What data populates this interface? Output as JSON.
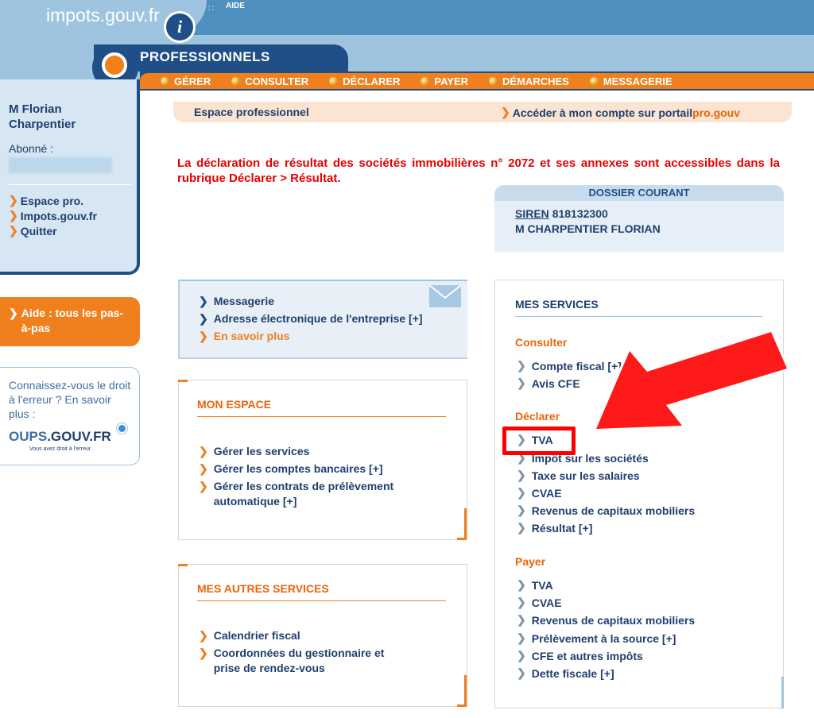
{
  "header": {
    "brand": "impots.gouv.fr",
    "info_glyph": "i",
    "aide_label": "AIDE",
    "section_title": "PROFESSIONNELS"
  },
  "nav": {
    "items": [
      {
        "label": "GÉRER"
      },
      {
        "label": "CONSULTER"
      },
      {
        "label": "DÉCLARER"
      },
      {
        "label": "PAYER"
      },
      {
        "label": "DÉMARCHES"
      },
      {
        "label": "MESSAGERIE"
      }
    ]
  },
  "sidebar": {
    "user_name": "M  Florian Charpentier",
    "abonne_label": "Abonné :",
    "links": [
      {
        "label": "Espace pro."
      },
      {
        "label": "Impots.gouv.fr"
      },
      {
        "label": "Quitter"
      }
    ],
    "aide_text": "Aide : tous les pas-à-pas",
    "droit_text": "Connaissez-vous le droit à l'erreur ? En savoir plus :",
    "oups_part1": "OUPS",
    "oups_part2": ".GOUV.FR",
    "oups_tag": "Vous avez droit à l'erreur"
  },
  "espace_bar": {
    "title": "Espace professionnel",
    "portail_text": "Accéder à mon compte sur portail",
    "portail_pro": "pro.gouv"
  },
  "alert": "La déclaration de résultat des sociétés immobilières n° 2072 et ses annexes sont accessibles dans la rubrique Déclarer > Résultat.",
  "dossier": {
    "heading": "DOSSIER COURANT",
    "siren_label": "SIREN",
    "siren_value": "818132300",
    "name": "M CHARPENTIER FLORIAN"
  },
  "messagerie_box": {
    "links": [
      {
        "label": "Messagerie"
      },
      {
        "label": "Adresse électronique de l'entreprise [+]"
      },
      {
        "label": "En savoir plus"
      }
    ]
  },
  "mon_espace": {
    "title": "MON ESPACE",
    "links": [
      {
        "label": "Gérer les services"
      },
      {
        "label": "Gérer les comptes bancaires [+]"
      },
      {
        "label": "Gérer les contrats de prélèvement automatique [+]"
      }
    ]
  },
  "autres_services": {
    "title": "MES AUTRES SERVICES",
    "links": [
      {
        "label": "Calendrier fiscal"
      },
      {
        "label": "Coordonnées du gestionnaire et prise de rendez-vous"
      }
    ]
  },
  "mes_services": {
    "title": "MES SERVICES",
    "consulter": {
      "title": "Consulter",
      "items": [
        {
          "label": "Compte fiscal [+]"
        },
        {
          "label": "Avis CFE"
        }
      ]
    },
    "declarer": {
      "title": "Déclarer",
      "items": [
        {
          "label": "TVA"
        },
        {
          "label": "Impôt sur les sociétés"
        },
        {
          "label": "Taxe sur les salaires"
        },
        {
          "label": "CVAE"
        },
        {
          "label": "Revenus de capitaux mobiliers"
        },
        {
          "label": "Résultat [+]"
        }
      ]
    },
    "payer": {
      "title": "Payer",
      "items": [
        {
          "label": "TVA"
        },
        {
          "label": "CVAE"
        },
        {
          "label": "Revenus de capitaux mobiliers"
        },
        {
          "label": "Prélèvement à la source [+]"
        },
        {
          "label": "CFE et autres impôts"
        },
        {
          "label": "Dette fiscale [+]"
        }
      ]
    }
  },
  "colors": {
    "navy": "#1f4f86",
    "orange": "#f0801e",
    "annotation_red": "#ff0000",
    "alert_red": "#e60000"
  }
}
